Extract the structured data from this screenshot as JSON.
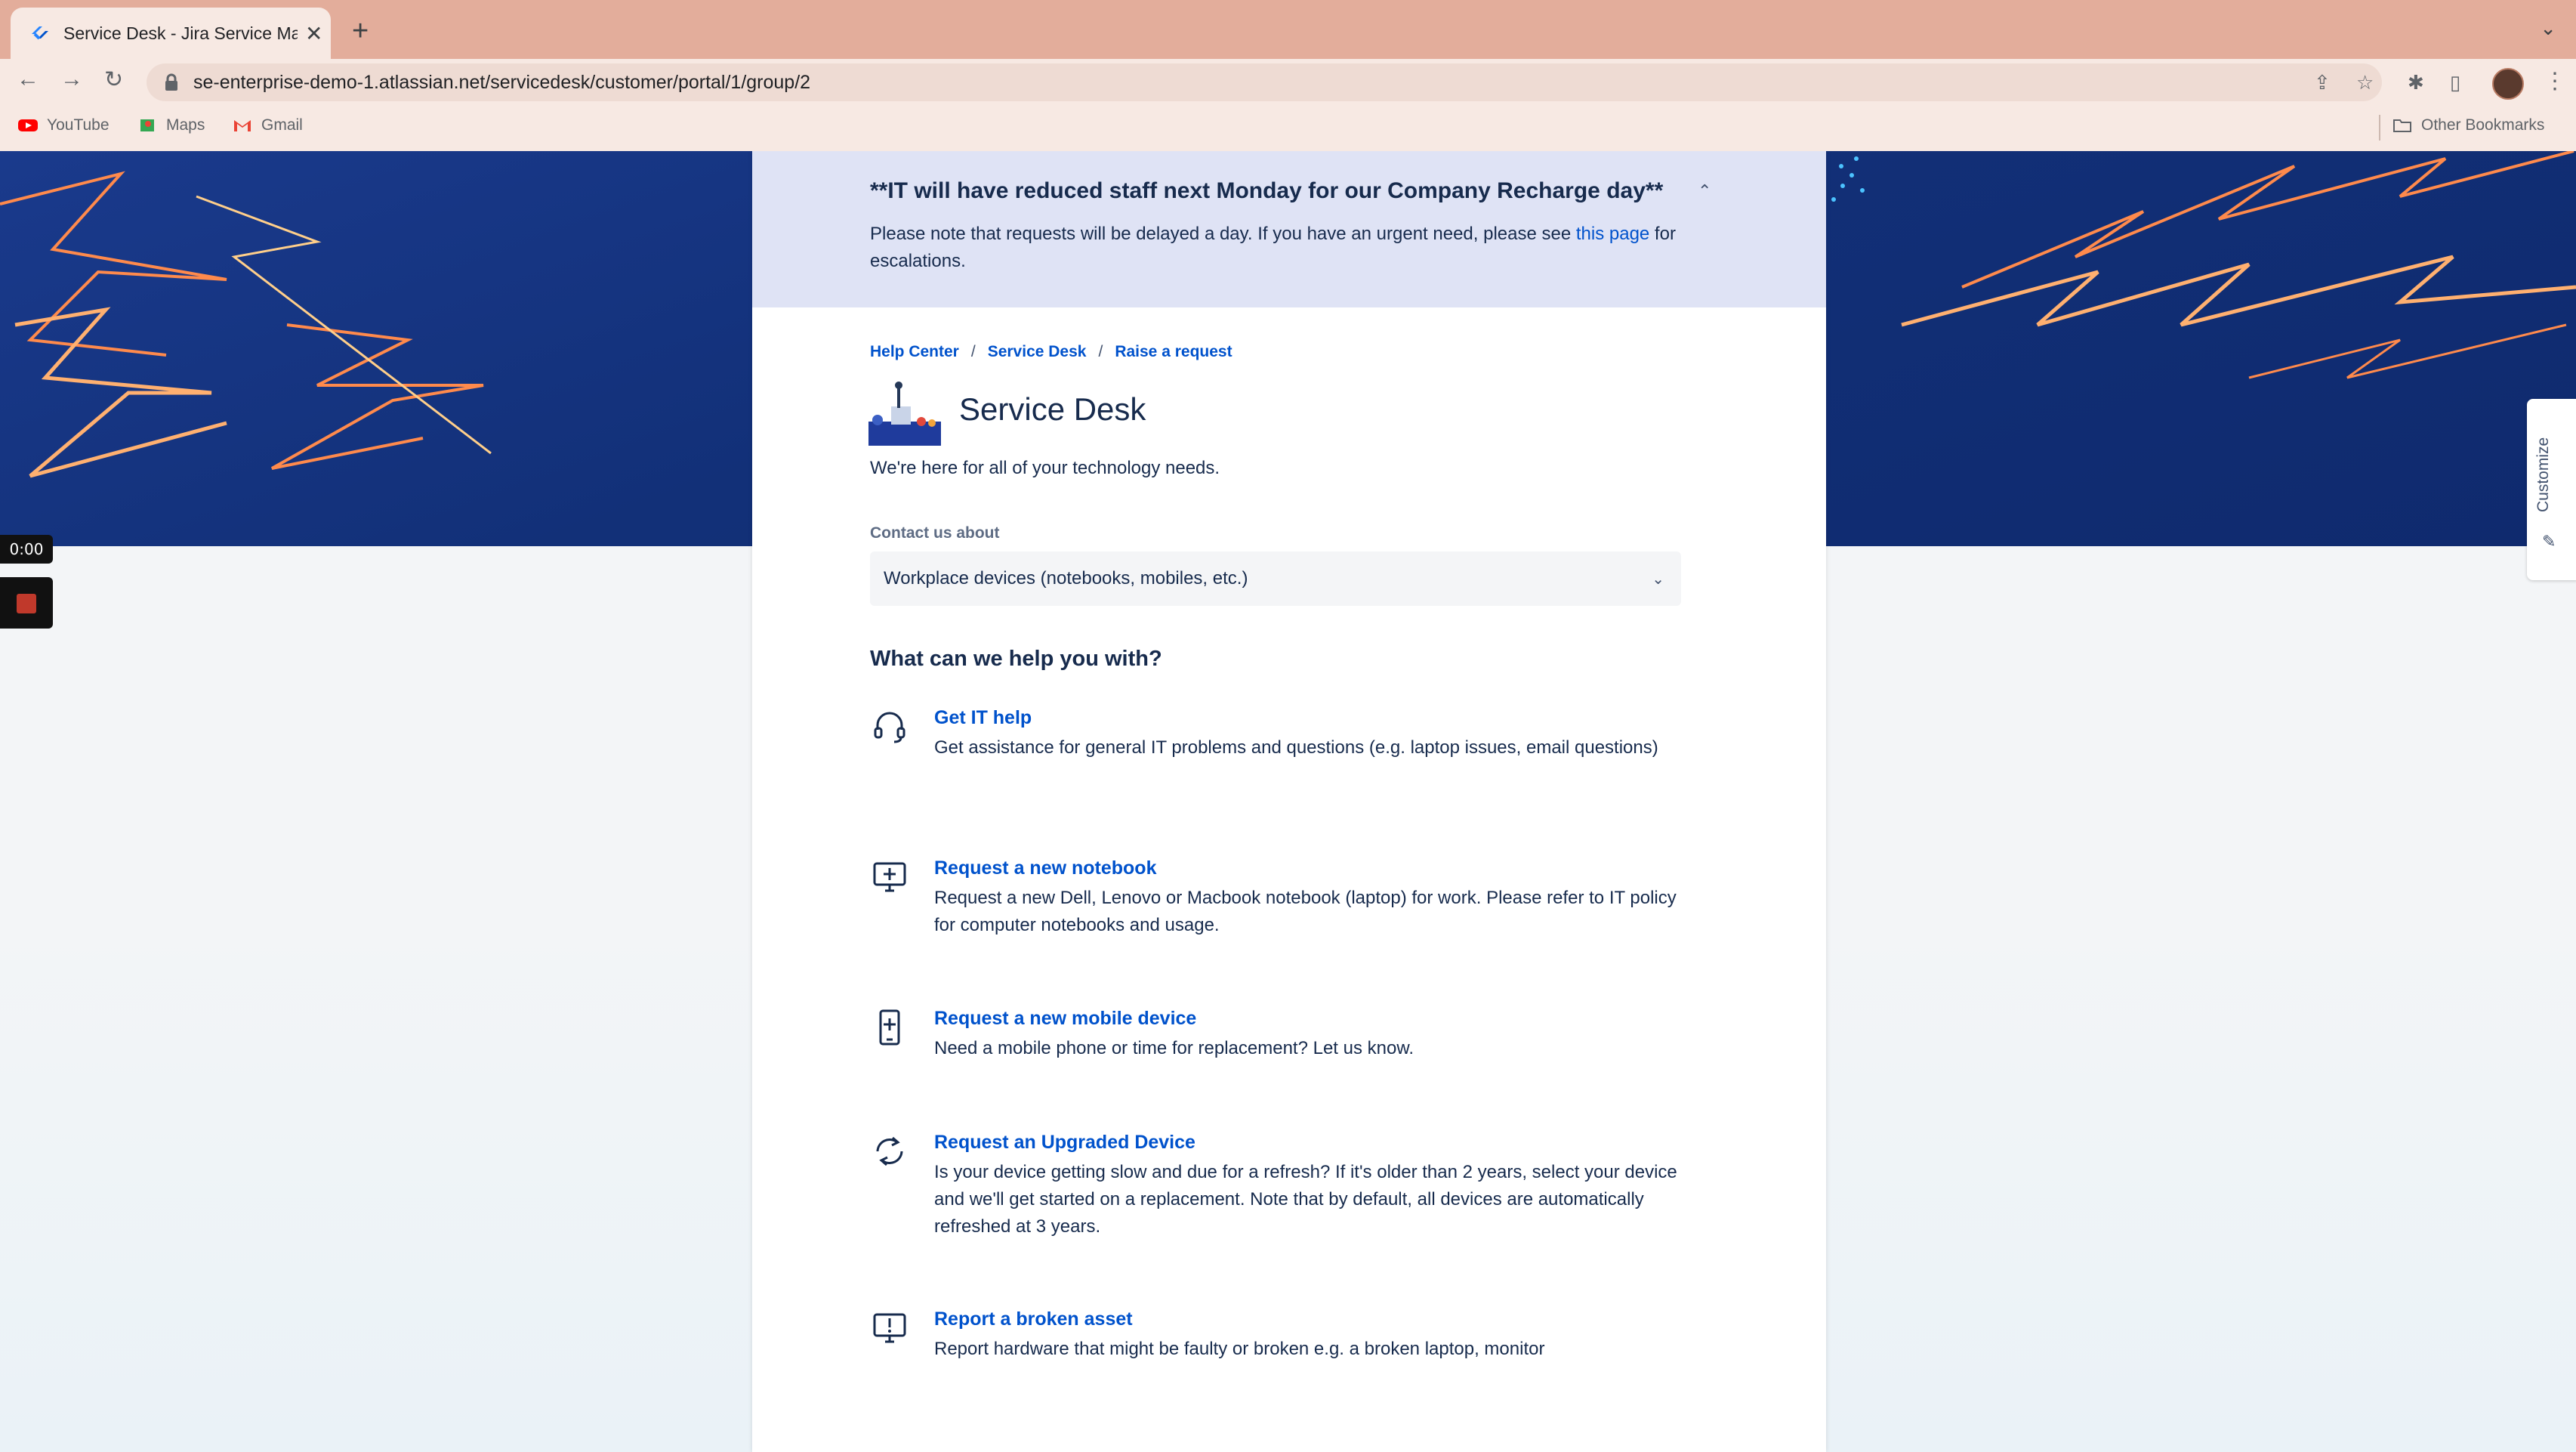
{
  "browser": {
    "tab_title": "Service Desk - Jira Service Ma",
    "url": "se-enterprise-demo-1.atlassian.net/servicedesk/customer/portal/1/group/2",
    "bookmarks": [
      "YouTube",
      "Maps",
      "Gmail"
    ],
    "other_bookmarks": "Other Bookmarks"
  },
  "recorder": {
    "time": "0:00"
  },
  "banner": {
    "title": "**IT will have reduced staff next Monday for our Company Recharge day**",
    "text_before": "Please note that requests will be delayed a day. If you have an urgent need, please see ",
    "link": "this page",
    "text_after": " for escalations."
  },
  "breadcrumb": [
    "Help Center",
    "Service Desk",
    "Raise a request"
  ],
  "desk": {
    "title": "Service Desk",
    "description": "We're here for all of your technology needs."
  },
  "contact": {
    "label": "Contact us about",
    "selected": "Workplace devices (notebooks, mobiles, etc.)"
  },
  "help_heading": "What can we help you with?",
  "request_types": [
    {
      "icon": "headset-icon",
      "title": "Get IT help",
      "description": "Get assistance for general IT problems and questions (e.g. laptop issues, email questions)"
    },
    {
      "icon": "monitor-plus-icon",
      "title": "Request a new notebook",
      "description": "Request a new Dell, Lenovo or Macbook notebook (laptop) for work. Please refer to IT policy for computer notebooks and usage."
    },
    {
      "icon": "mobile-plus-icon",
      "title": "Request a new mobile device",
      "description": "Need a mobile phone or time for replacement? Let us know."
    },
    {
      "icon": "refresh-icon",
      "title": "Request an Upgraded Device",
      "description": "Is your device getting slow and due for a refresh? If it's older than 2 years, select your device and we'll get started on a replacement. Note that by default, all devices are automatically refreshed at 3 years."
    },
    {
      "icon": "monitor-alert-icon",
      "title": "Report a broken asset",
      "description": "Report hardware that might be faulty or broken e.g. a broken laptop, monitor"
    }
  ],
  "customize_label": "Customize"
}
